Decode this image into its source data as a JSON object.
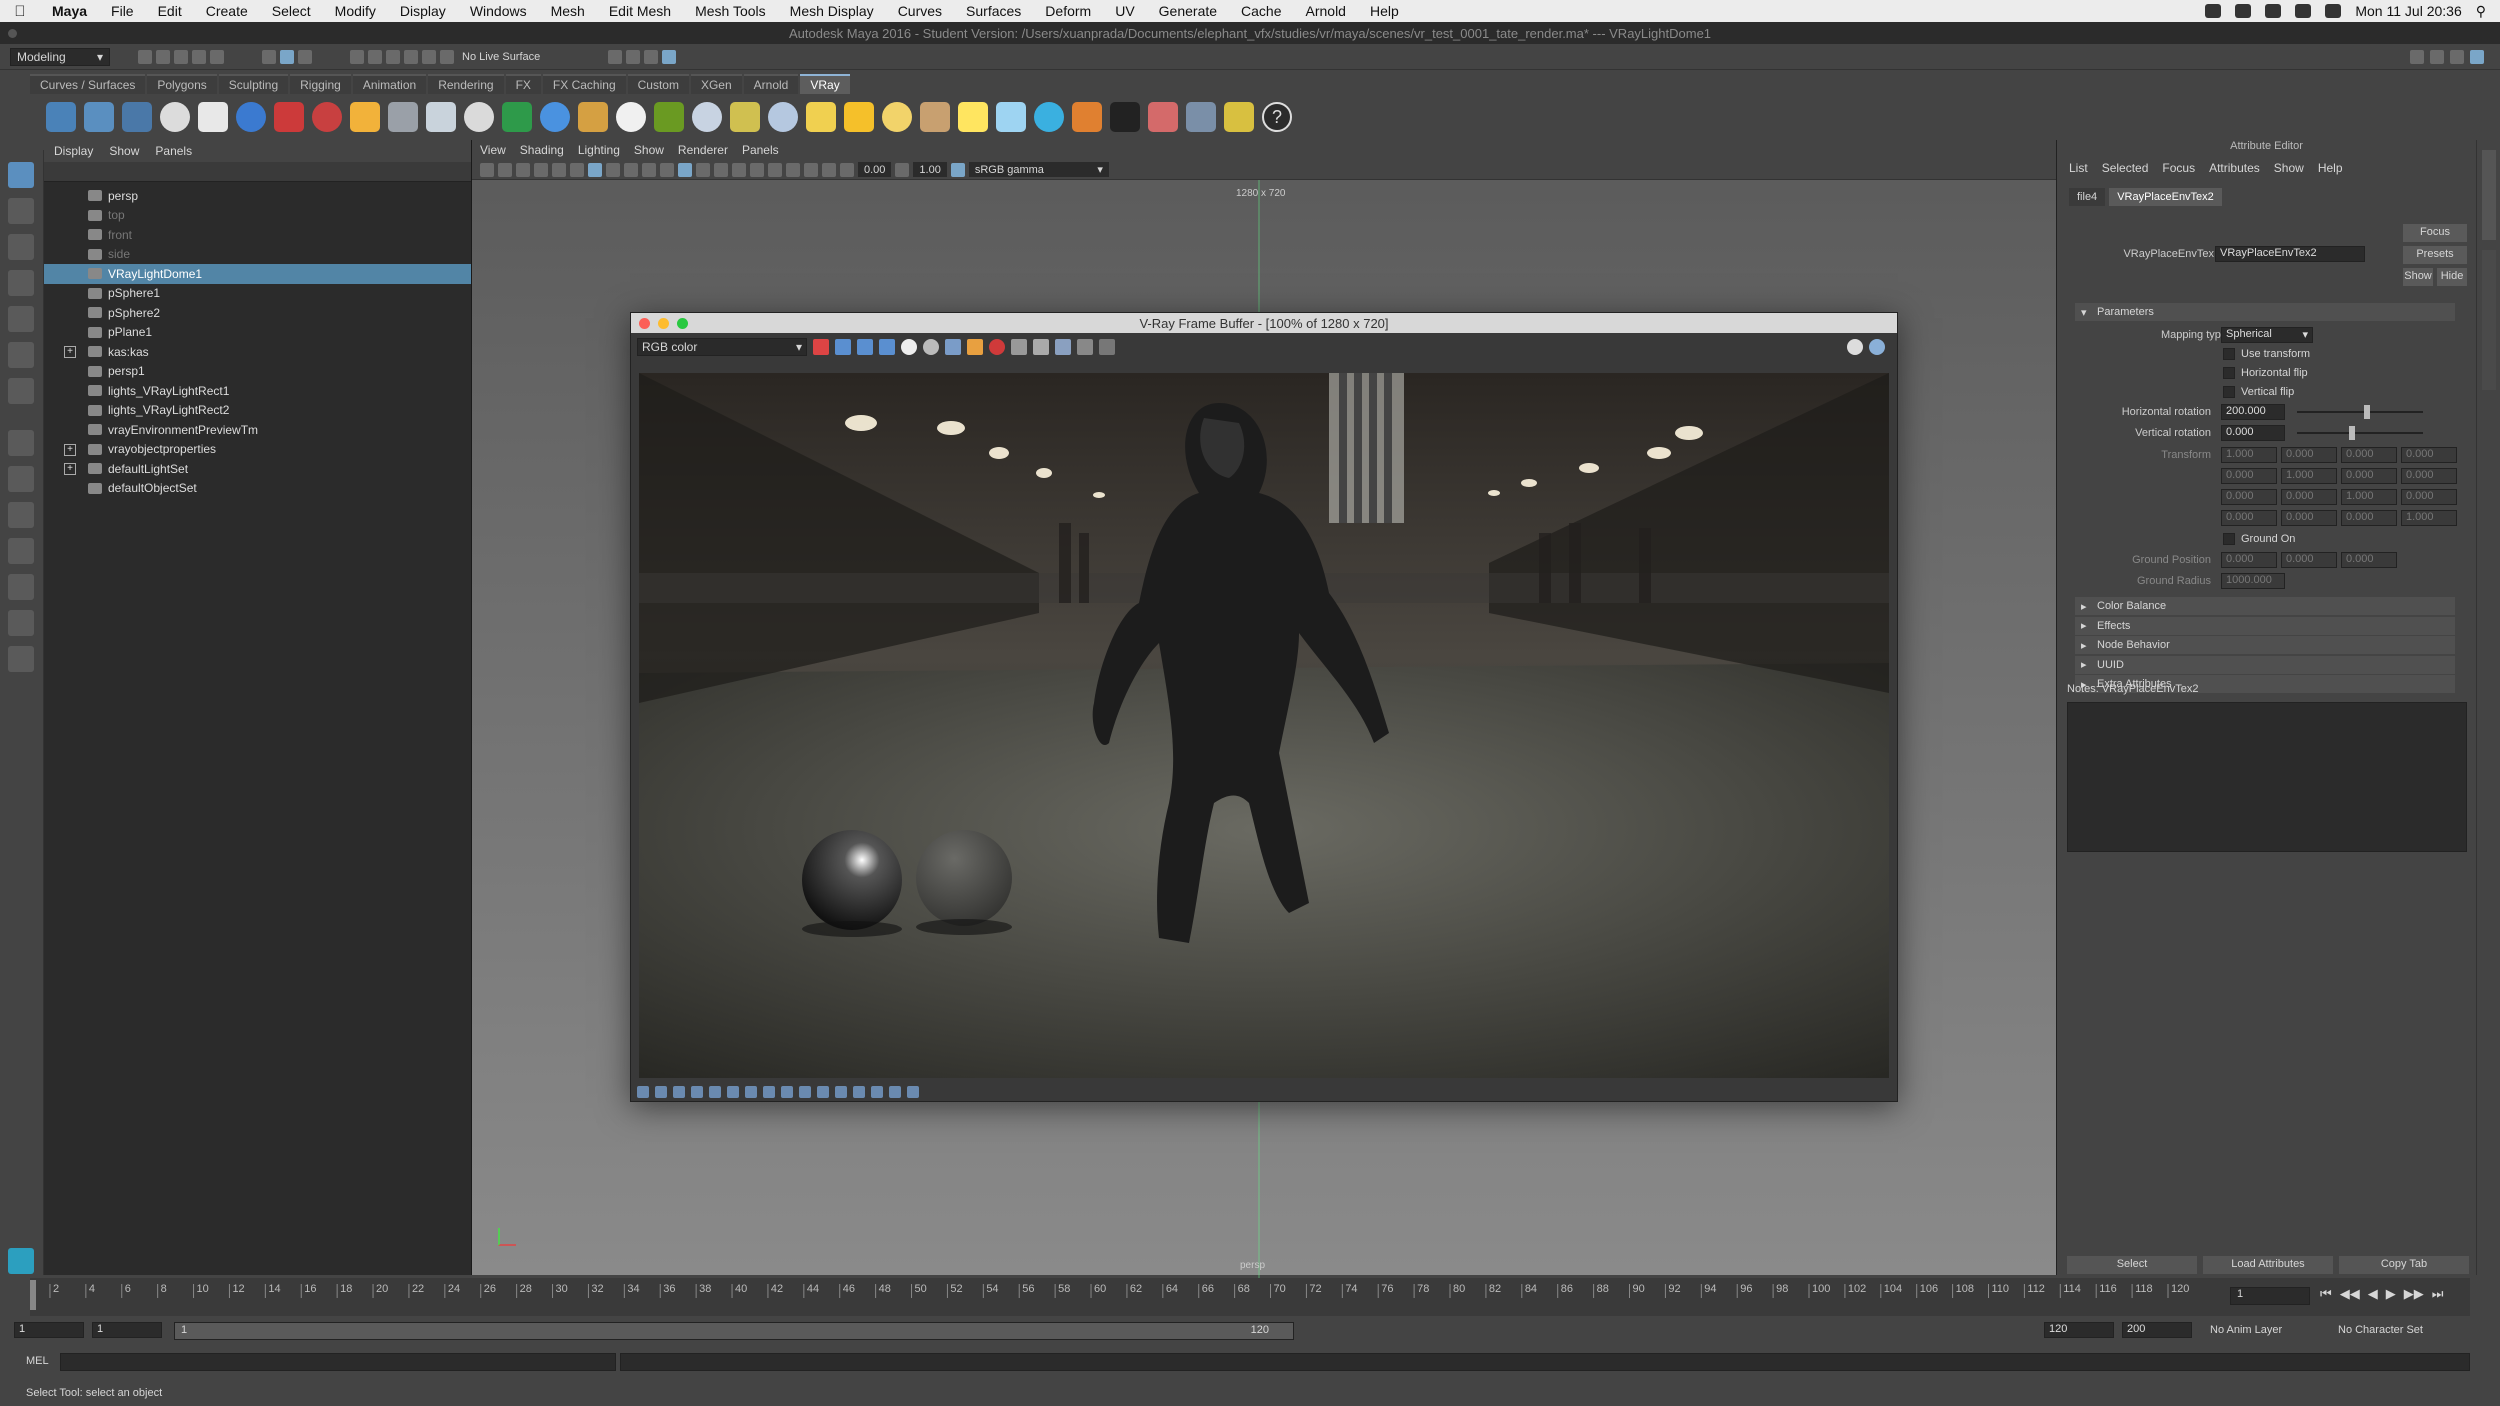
{
  "menubar": {
    "app": "Maya",
    "items": [
      "File",
      "Edit",
      "Create",
      "Select",
      "Modify",
      "Display",
      "Windows",
      "Mesh",
      "Edit Mesh",
      "Mesh Tools",
      "Mesh Display",
      "Curves",
      "Surfaces",
      "Deform",
      "UV",
      "Generate",
      "Cache",
      "Arnold",
      "Help"
    ],
    "clock": "Mon 11 Jul  20:36"
  },
  "titlebar": {
    "title": "Autodesk Maya 2016 - Student Version: /Users/xuanprada/Documents/elephant_vfx/studies/vr/maya/scenes/vr_test_0001_tate_render.ma*   ---   VRayLightDome1"
  },
  "statusline": {
    "mode": "Modeling",
    "live_surface": "No Live Surface"
  },
  "shelf": {
    "tabs": [
      "Curves / Surfaces",
      "Polygons",
      "Sculpting",
      "Rigging",
      "Animation",
      "Rendering",
      "FX",
      "FX Caching",
      "Custom",
      "XGen",
      "Arnold",
      "VRay"
    ],
    "active_tab": "VRay"
  },
  "outliner": {
    "menu": [
      "Display",
      "Show",
      "Panels"
    ],
    "items": [
      {
        "label": "persp",
        "dim": false,
        "selected": false,
        "expand": false
      },
      {
        "label": "top",
        "dim": true,
        "selected": false,
        "expand": false
      },
      {
        "label": "front",
        "dim": true,
        "selected": false,
        "expand": false
      },
      {
        "label": "side",
        "dim": true,
        "selected": false,
        "expand": false
      },
      {
        "label": "VRayLightDome1",
        "dim": false,
        "selected": true,
        "expand": false
      },
      {
        "label": "pSphere1",
        "dim": false,
        "selected": false,
        "expand": false
      },
      {
        "label": "pSphere2",
        "dim": false,
        "selected": false,
        "expand": false
      },
      {
        "label": "pPlane1",
        "dim": false,
        "selected": false,
        "expand": false
      },
      {
        "label": "kas:kas",
        "dim": false,
        "selected": false,
        "expand": true
      },
      {
        "label": "persp1",
        "dim": false,
        "selected": false,
        "expand": false
      },
      {
        "label": "lights_VRayLightRect1",
        "dim": false,
        "selected": false,
        "expand": false
      },
      {
        "label": "lights_VRayLightRect2",
        "dim": false,
        "selected": false,
        "expand": false
      },
      {
        "label": "vrayEnvironmentPreviewTm",
        "dim": false,
        "selected": false,
        "expand": false
      },
      {
        "label": "vrayobjectproperties",
        "dim": false,
        "selected": false,
        "expand": true
      },
      {
        "label": "defaultLightSet",
        "dim": false,
        "selected": false,
        "expand": true
      },
      {
        "label": "defaultObjectSet",
        "dim": false,
        "selected": false,
        "expand": false
      }
    ]
  },
  "viewport": {
    "menu": [
      "View",
      "Shading",
      "Lighting",
      "Show",
      "Renderer",
      "Panels"
    ],
    "exposure": "0.00",
    "gamma": "1.00",
    "color_space": "sRGB gamma",
    "resolution_gate": "1280 x 720",
    "camera": "persp"
  },
  "vfb": {
    "title": "V-Ray Frame Buffer - [100% of 1280 x 720]",
    "channel": "RGB color"
  },
  "attribute_editor": {
    "header": "Attribute Editor",
    "menu": [
      "List",
      "Selected",
      "Focus",
      "Attributes",
      "Show",
      "Help"
    ],
    "tabs": [
      "file4",
      "VRayPlaceEnvTex2"
    ],
    "node_label": "VRayPlaceEnvTex:",
    "node_value": "VRayPlaceEnvTex2",
    "buttons": {
      "focus": "Focus",
      "presets": "Presets",
      "show": "Show",
      "hide": "Hide"
    },
    "parameters_title": "Parameters",
    "mapping_type_label": "Mapping type",
    "mapping_type": "Spherical",
    "use_transform": "Use transform",
    "horizontal_flip": "Horizontal flip",
    "vertical_flip": "Vertical flip",
    "hrot_label": "Horizontal rotation",
    "hrot": "200.000",
    "vrot_label": "Vertical rotation",
    "vrot": "0.000",
    "transform_label": "Transform",
    "transform": [
      [
        "1.000",
        "0.000",
        "0.000",
        "0.000"
      ],
      [
        "0.000",
        "1.000",
        "0.000",
        "0.000"
      ],
      [
        "0.000",
        "0.000",
        "1.000",
        "0.000"
      ],
      [
        "0.000",
        "0.000",
        "0.000",
        "1.000"
      ]
    ],
    "ground_on": "Ground On",
    "ground_position_label": "Ground Position",
    "ground_position": [
      "0.000",
      "0.000",
      "0.000"
    ],
    "ground_radius_label": "Ground Radius",
    "ground_radius": "1000.000",
    "sections": [
      "Color Balance",
      "Effects",
      "Node Behavior",
      "UUID",
      "Extra Attributes"
    ],
    "notes_label": "Notes:  VRayPlaceEnvTex2",
    "bottom_buttons": [
      "Select",
      "Load Attributes",
      "Copy Tab"
    ]
  },
  "timeline": {
    "ticks": [
      2,
      4,
      6,
      8,
      10,
      12,
      14,
      16,
      18,
      20,
      22,
      24,
      26,
      28,
      30,
      32,
      34,
      36,
      38,
      40,
      42,
      44,
      46,
      48,
      50,
      52,
      54,
      56,
      58,
      60,
      62,
      64,
      66,
      68,
      70,
      72,
      74,
      76,
      78,
      80,
      82,
      84,
      86,
      88,
      90,
      92,
      94,
      96,
      98,
      100,
      102,
      104,
      106,
      108,
      110,
      112,
      114,
      116,
      118,
      120
    ],
    "current_frame": "1"
  },
  "range": {
    "start": "1",
    "playback_start": "1",
    "slider_start": "1",
    "slider_end": "120",
    "playback_end": "120",
    "end": "200",
    "anim_layer": "No Anim Layer",
    "character_set": "No Character Set"
  },
  "cmdline": {
    "label": "MEL"
  },
  "helpline": {
    "text": "Select Tool: select an object"
  }
}
